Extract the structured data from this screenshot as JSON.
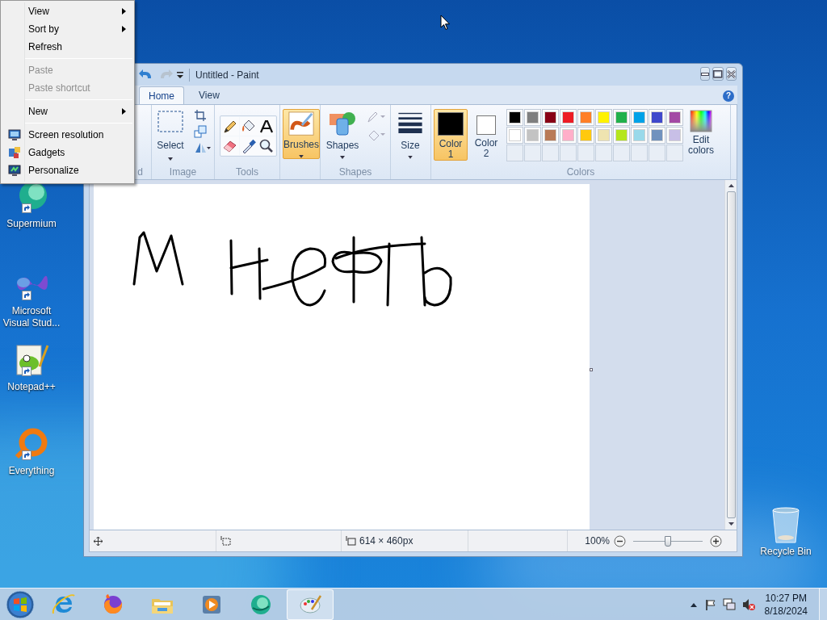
{
  "context_menu": {
    "items": [
      {
        "label": "View",
        "kind": "submenu",
        "disabled": false
      },
      {
        "label": "Sort by",
        "kind": "submenu",
        "disabled": false
      },
      {
        "label": "Refresh",
        "kind": "command",
        "disabled": false
      },
      {
        "kind": "separator"
      },
      {
        "label": "Paste",
        "kind": "command",
        "disabled": true
      },
      {
        "label": "Paste shortcut",
        "kind": "command",
        "disabled": true
      },
      {
        "kind": "separator"
      },
      {
        "label": "New",
        "kind": "submenu",
        "disabled": false
      },
      {
        "kind": "separator"
      },
      {
        "label": "Screen resolution",
        "kind": "icon-command",
        "disabled": false
      },
      {
        "label": "Gadgets",
        "kind": "icon-command",
        "disabled": false
      },
      {
        "label": "Personalize",
        "kind": "icon-command",
        "disabled": false
      }
    ]
  },
  "paint": {
    "title": "Untitled - Paint",
    "tabs": [
      {
        "label": "Home",
        "selected": true
      },
      {
        "label": "View",
        "selected": false
      }
    ],
    "help_button": "?",
    "ribbon": {
      "clipboard_label": "d",
      "image": {
        "select_label": "Select",
        "group_label": "Image"
      },
      "tools_label": "Tools",
      "brushes": {
        "label": "Brushes",
        "selected": true
      },
      "shapes": {
        "label": "Shapes",
        "group_label": "Shapes"
      },
      "size_label": "Size",
      "color_slots": [
        {
          "label": "Color 1",
          "color": "#000000",
          "selected": true
        },
        {
          "label": "Color 2",
          "color": "#ffffff",
          "selected": false
        }
      ],
      "palette": [
        {
          "color": "#000000"
        },
        {
          "color": "#7f7f7f"
        },
        {
          "color": "#880015"
        },
        {
          "color": "#ed1c24"
        },
        {
          "color": "#ff7f27"
        },
        {
          "color": "#fff200"
        },
        {
          "color": "#22b14c"
        },
        {
          "color": "#00a2e8"
        },
        {
          "color": "#3f48cc"
        },
        {
          "color": "#a349a4"
        },
        {
          "color": "#ffffff"
        },
        {
          "color": "#c3c3c3"
        },
        {
          "color": "#b97a57"
        },
        {
          "color": "#ffaec9"
        },
        {
          "color": "#ffc90e"
        },
        {
          "color": "#efe4b0"
        },
        {
          "color": "#b5e61d"
        },
        {
          "color": "#99d9ea"
        },
        {
          "color": "#7092be"
        },
        {
          "color": "#c8bfe7"
        }
      ],
      "edit_colors_label": "Edit colors",
      "colors_label": "Colors"
    },
    "status_bar": {
      "dimensions": "614 × 460px",
      "zoom": "100%",
      "zoom_slider": {
        "level": 0.5
      }
    }
  },
  "desktop_icons": [
    {
      "label": "Supermium"
    },
    {
      "label": "Microsoft Visual Stud..."
    },
    {
      "label": "Notepad++"
    },
    {
      "label": "Everything"
    },
    {
      "label": "Recycle Bin"
    }
  ],
  "taskbar": {
    "items": [
      {
        "active": false
      },
      {
        "active": false
      },
      {
        "active": false
      },
      {
        "active": false
      },
      {
        "active": false
      },
      {
        "active": true
      }
    ],
    "clock": {
      "time": "10:27 PM",
      "date": "8/18/2024"
    }
  }
}
